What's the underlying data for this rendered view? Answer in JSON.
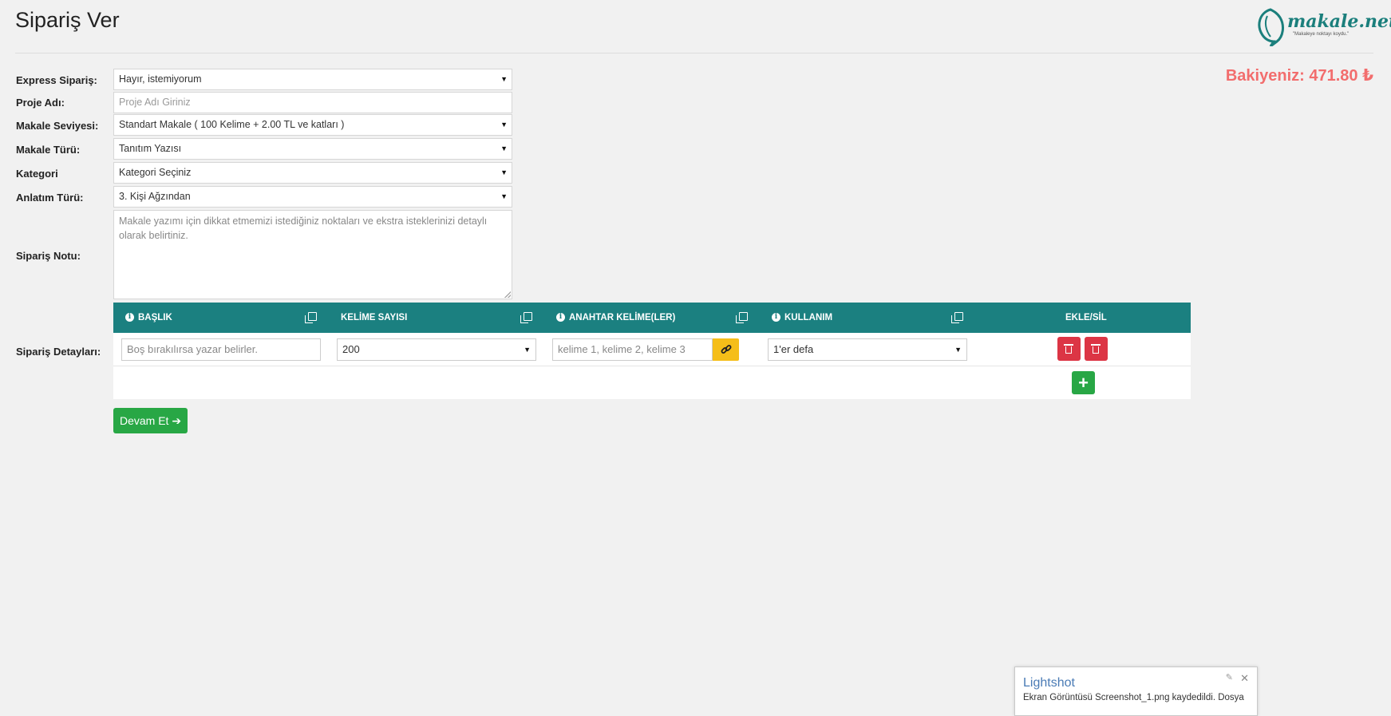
{
  "header": {
    "title": "Sipariş Ver",
    "logo_text": "makale.net",
    "logo_tagline": "\"Makaleye noktayı koydu.\"",
    "balance": "Bakiyeniz: 471.80 ₺"
  },
  "form": {
    "express": {
      "label": "Express Sipariş:",
      "value": "Hayır, istemiyorum"
    },
    "project": {
      "label": "Proje Adı:",
      "placeholder": "Proje Adı Giriniz"
    },
    "level": {
      "label": "Makale Seviyesi:",
      "value": "Standart Makale ( 100 Kelime + 2.00 TL ve katları )"
    },
    "type": {
      "label": "Makale Türü:",
      "value": "Tanıtım Yazısı"
    },
    "category": {
      "label": "Kategori",
      "value": "Kategori Seçiniz"
    },
    "narration": {
      "label": "Anlatım Türü:",
      "value": "3. Kişi Ağzından"
    },
    "note": {
      "label": "Sipariş Notu:",
      "placeholder": "Makale yazımı için dikkat etmemizi istediğiniz noktaları ve ekstra isteklerinizi detaylı olarak belirtiniz."
    },
    "details_label": "Sipariş Detayları:"
  },
  "table": {
    "headers": [
      "BAŞLIK",
      "KELİME SAYISI",
      "ANAHTAR KELİME(LER)",
      "KULLANIM",
      "EKLE/SİL"
    ],
    "row": {
      "title_placeholder": "Boş bırakılırsa yazar belirler.",
      "word_count": "200",
      "keywords_placeholder": "kelime 1, kelime 2, kelime 3",
      "usage": "1'er defa"
    }
  },
  "buttons": {
    "continue": "Devam Et"
  },
  "colors": {
    "accent": "#1b8080",
    "danger": "#dc3545",
    "success": "#28a745",
    "warning": "#f5be19",
    "balance": "#f26d6d"
  },
  "toast": {
    "title": "Lightshot",
    "body": "Ekran Görüntüsü Screenshot_1.png kaydedildi. Dosya"
  }
}
